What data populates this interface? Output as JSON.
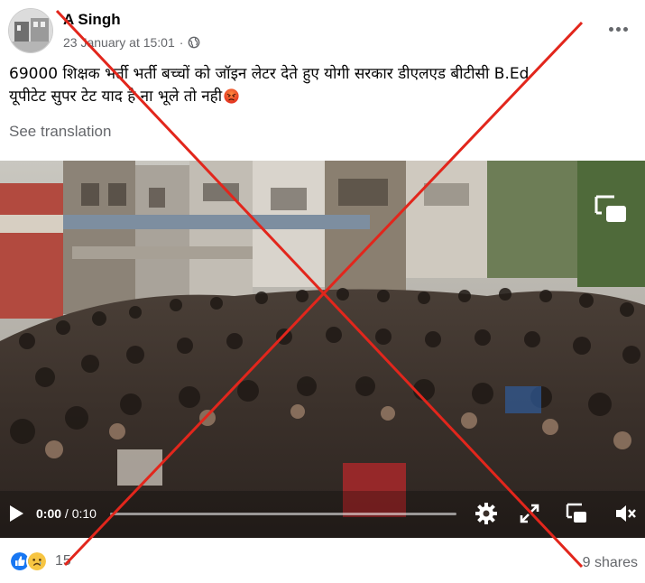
{
  "post": {
    "author": "A Singh",
    "timestamp": "23 January at 15:01",
    "privacy_icon": "globe-icon",
    "text_line1": "69000 शिक्षक भर्ती भर्ती बच्चों को जॉइन लेटर देते हुए योगी सरकार डीएलएड बीटीसी B.Ed",
    "text_line2": "यूपीटेट सुपर टेट याद है ना भूले तो नही",
    "emoji": "angry-face-icon",
    "see_translation": "See translation"
  },
  "video": {
    "current_time": "0:00",
    "duration": "/ 0:10",
    "progress": 0,
    "controls": [
      "play-icon",
      "settings-icon",
      "fullscreen-icon",
      "picture-in-picture-icon",
      "volume-muted-icon"
    ]
  },
  "footer": {
    "reactions": [
      "like-icon",
      "sad-icon"
    ],
    "reaction_count": "15",
    "shares": "9 shares"
  },
  "overlay": {
    "cross_color": "#e2261c"
  }
}
